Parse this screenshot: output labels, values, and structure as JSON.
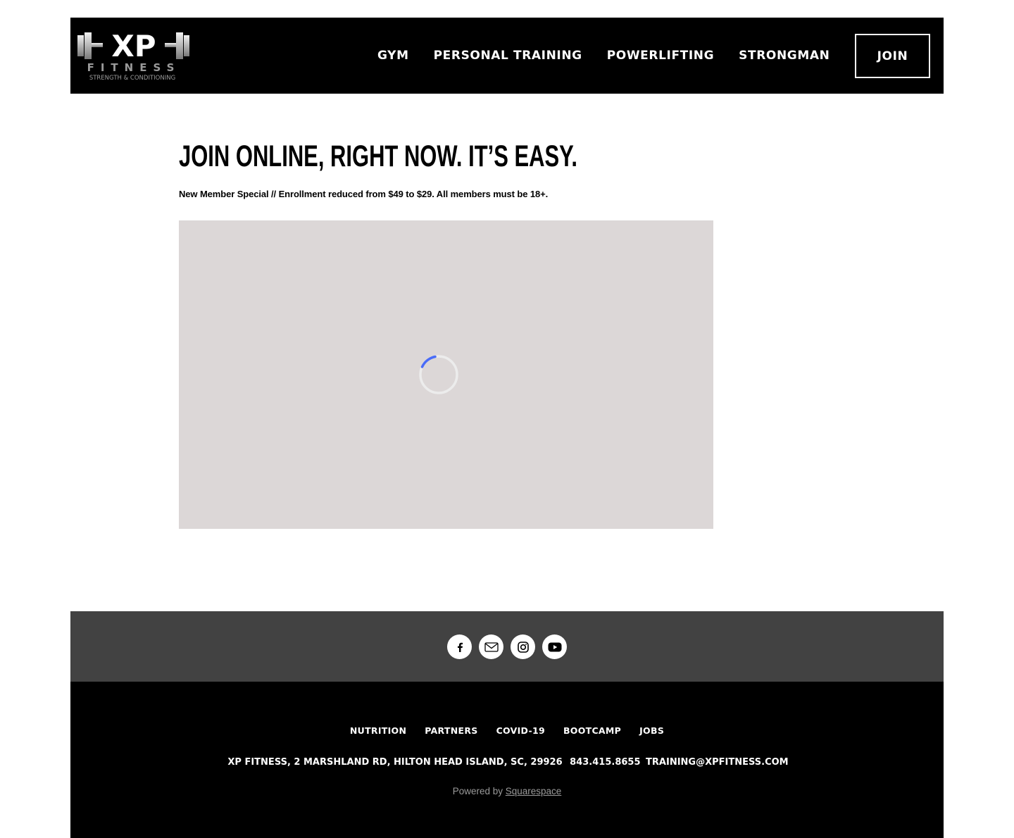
{
  "header": {
    "logo": {
      "brand": "XP",
      "word": "FITNESS",
      "tagline": "STRENGTH & CONDITIONING"
    },
    "nav": [
      {
        "label": "GYM"
      },
      {
        "label": "PERSONAL TRAINING"
      },
      {
        "label": "POWERLIFTING"
      },
      {
        "label": "STRONGMAN"
      }
    ],
    "join_label": "JOIN"
  },
  "main": {
    "title": "JOIN ONLINE, RIGHT NOW. IT’S EASY.",
    "subtitle": "New Member Special // Enrollment reduced from $49 to $29. All members must be 18+.",
    "embed": {
      "state": "loading",
      "spinner_color": "#4a6cf7"
    }
  },
  "footer": {
    "social": [
      {
        "icon": "facebook-icon"
      },
      {
        "icon": "email-icon"
      },
      {
        "icon": "instagram-icon"
      },
      {
        "icon": "youtube-icon"
      }
    ],
    "nav": [
      {
        "label": "NUTRITION"
      },
      {
        "label": "PARTNERS"
      },
      {
        "label": "COVID-19"
      },
      {
        "label": "BOOTCAMP"
      },
      {
        "label": "JOBS"
      }
    ],
    "address": "XP FITNESS, 2 MARSHLAND RD, HILTON HEAD ISLAND, SC, 29926",
    "phone": "843.415.8655",
    "email": "TRAINING@XPFITNESS.COM",
    "powered_prefix": "Powered by",
    "powered_link": "Squarespace"
  },
  "colors": {
    "header_bg": "#000000",
    "social_band_bg": "#424242",
    "embed_bg": "#dcd7d7",
    "text_light": "#ffffff",
    "powered_text": "#9a9a9a"
  }
}
